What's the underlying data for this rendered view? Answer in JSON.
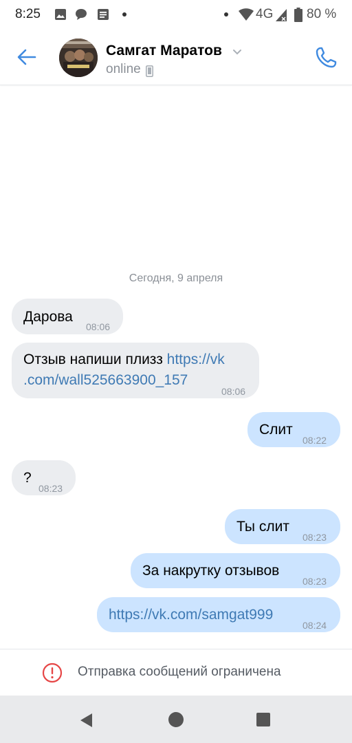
{
  "status_bar": {
    "time": "8:25",
    "network": "4G",
    "battery": "80 %",
    "icons": [
      "image-icon",
      "chat-icon",
      "news-icon",
      "dot-icon",
      "wifi-icon",
      "signal-icon",
      "battery-icon"
    ]
  },
  "header": {
    "contact_name": "Самгат Маратов",
    "status": "online",
    "accent_color": "#3f8ae0"
  },
  "chat": {
    "date_separator": "Сегодня, 9 апреля",
    "messages": [
      {
        "direction": "in",
        "text": "Дарова",
        "time": "08:06"
      },
      {
        "direction": "in",
        "text": "Отзыв напиши плизз ",
        "link_part1": "https://vk",
        "link_part2": ".com/wall525663900_157",
        "time": "08:06"
      },
      {
        "direction": "out",
        "text": "Слит",
        "time": "08:22"
      },
      {
        "direction": "in",
        "text": "?",
        "time": "08:23"
      },
      {
        "direction": "out",
        "text": "Ты слит",
        "time": "08:23"
      },
      {
        "direction": "out",
        "text": "За накрутку отзывов",
        "time": "08:23"
      },
      {
        "direction": "out",
        "link": "https://vk.com/samgat999",
        "time": "08:24"
      }
    ]
  },
  "footer": {
    "restriction_text": "Отправка сообщений ограничена",
    "warning_color": "#e64646"
  },
  "colors": {
    "incoming_bubble": "#ebedf0",
    "outgoing_bubble": "#cce4ff",
    "link": "#3f7ab4"
  }
}
